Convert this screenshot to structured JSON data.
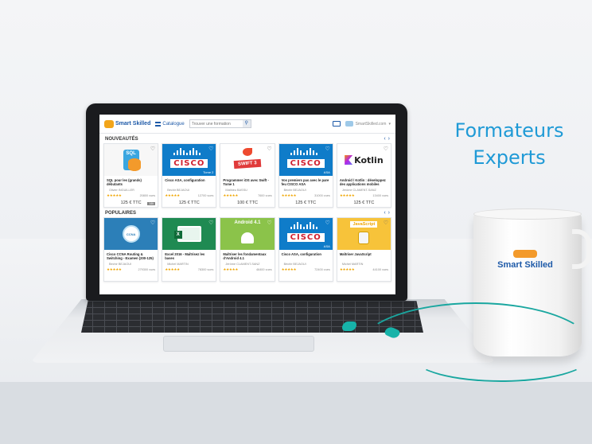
{
  "headline": {
    "line1": "Formateurs",
    "line2": "Experts"
  },
  "app": {
    "logo_text": "Smart Skilled",
    "catalog_label": "Catalogue",
    "search_placeholder": "Trouver une formation",
    "user_label": "SmartSkilled.com"
  },
  "sections": [
    {
      "title": "NOUVEAUTÉS",
      "cards": [
        {
          "title": "SQL pour les (grands) débutants",
          "author": "Olivier INGUILLER",
          "count": "20800 vues",
          "price": "125 € TTC",
          "badge": "14h"
        },
        {
          "title": "Cisco ASA, configuration",
          "author": "Béchir BEJAOUI",
          "count": "12700 vues",
          "price": "125 € TTC"
        },
        {
          "title": "Programmer iOS avec Swift - Tome 1",
          "author": "Mathieu BASSU",
          "count": "7600 vues",
          "price": "100 € TTC"
        },
        {
          "title": "Vos premiers pas avec le pare feu CISCO ASA",
          "author": "Béchir BEJAOUI",
          "count": "31000 vues",
          "price": "125 € TTC"
        },
        {
          "title": "Android / Kotlin : développez des applications mobiles",
          "author": "Jérôme CLAMENT-SANZ",
          "count": "13400 vues",
          "price": "125 € TTC"
        }
      ]
    },
    {
      "title": "POPULAIRES",
      "cards": [
        {
          "title": "Cisco CCNA Routing & Switching - Examen (200-125)",
          "author": "Béchir BEJAOUI",
          "count": "279300 vues"
        },
        {
          "title": "Excel 2016 - Maîtrisez les bases",
          "author": "Michel MARTIN",
          "count": "78300 vues"
        },
        {
          "title": "Maîtriser les fondamentaux d'Android 4.1",
          "author": "Jérôme CLAMENT-SANZ",
          "count": "46400 vues"
        },
        {
          "title": "Cisco ASA, configuration",
          "author": "Béchir BEJAOUI",
          "count": "72400 vues"
        },
        {
          "title": "Maîtriser JavaScript",
          "author": "Michel MARTIN",
          "count": "44100 vues"
        }
      ]
    }
  ],
  "thumb_text": {
    "sql": "SQL",
    "cisco": "CISCO",
    "asa": "ASA",
    "tome": "Tome 2",
    "swift": "SWIFT 3",
    "kotlin": "Kotlin",
    "ccna": "CCNA",
    "android": "Android 4.1",
    "js": "JavaScript"
  },
  "mug": {
    "name": "Smart Skilled"
  },
  "icons": {
    "heart": "♡",
    "star": "★★★★★",
    "prev": "‹",
    "next": "›",
    "search": "⚲"
  },
  "colors": {
    "accent": "#1f9ad6",
    "brand": "#1e5aa8",
    "star": "#f0a500"
  }
}
